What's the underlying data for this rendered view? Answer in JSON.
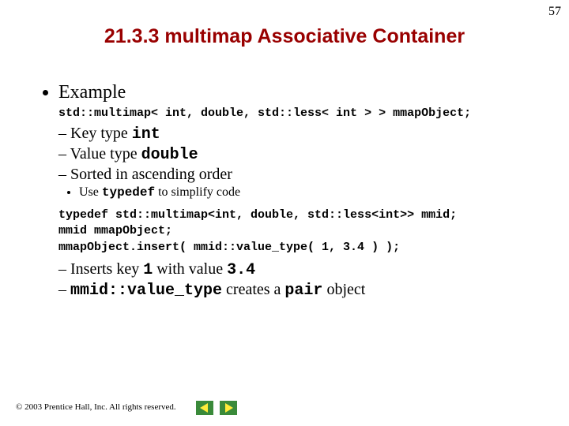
{
  "page_number": "57",
  "title": "21.3.3 multimap Associative Container",
  "section": {
    "heading": "Example",
    "declaration_line": "std::multimap< int, double, std::less< int > > mmapObject;",
    "bullets_1": [
      {
        "prefix": "Key type ",
        "code": "int"
      },
      {
        "prefix": "Value type ",
        "code": "double"
      },
      {
        "prefix": "Sorted in ascending order",
        "code": ""
      }
    ],
    "sub_bullet": {
      "prefix": "Use ",
      "code": "typedef",
      "suffix": " to simplify code"
    },
    "code_block": "typedef std::multimap<int, double, std::less<int>> mmid;\nmmid mmapObject;\nmmapObject.insert( mmid::value_type( 1, 3.4 ) );",
    "bullets_2": {
      "insert_line": {
        "p1": "Inserts key ",
        "c1": "1",
        "p2": " with value ",
        "c2": "3.4"
      },
      "valuetype_line": {
        "code": "mmid::value_type",
        "mid": " creates a ",
        "code2": "pair",
        "suffix": " object"
      }
    }
  },
  "footer": "© 2003 Prentice Hall, Inc. All rights reserved.",
  "nav": {
    "prev": "previous-slide",
    "next": "next-slide"
  }
}
